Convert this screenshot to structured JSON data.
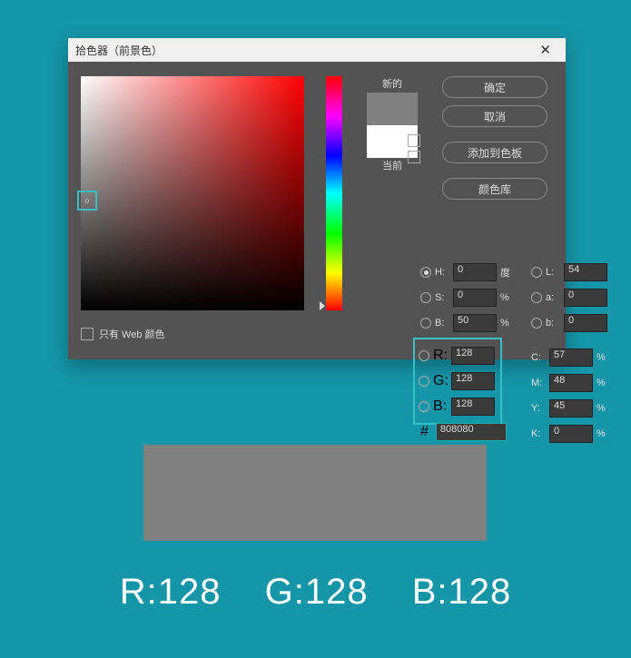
{
  "dialog": {
    "title": "拾色器（前景色）",
    "close": "✕"
  },
  "buttons": {
    "ok": "确定",
    "cancel": "取消",
    "add_swatch": "添加到色板",
    "color_lib": "颜色库"
  },
  "labels": {
    "new": "新的",
    "current": "当前",
    "web_only": "只有 Web 颜色"
  },
  "hsb": {
    "H": {
      "label": "H:",
      "value": "0",
      "unit": "度"
    },
    "S": {
      "label": "S:",
      "value": "0",
      "unit": "%"
    },
    "B": {
      "label": "B:",
      "value": "50",
      "unit": "%"
    }
  },
  "lab": {
    "L": {
      "label": "L:",
      "value": "54"
    },
    "a": {
      "label": "a:",
      "value": "0"
    },
    "b": {
      "label": "b:",
      "value": "0"
    }
  },
  "rgb": {
    "R": {
      "label": "R:",
      "value": "128"
    },
    "G": {
      "label": "G:",
      "value": "128"
    },
    "B": {
      "label": "B:",
      "value": "128"
    }
  },
  "cmyk": {
    "C": {
      "label": "C:",
      "value": "57",
      "unit": "%"
    },
    "M": {
      "label": "M:",
      "value": "48",
      "unit": "%"
    },
    "Y": {
      "label": "Y:",
      "value": "45",
      "unit": "%"
    },
    "K": {
      "label": "K:",
      "value": "0",
      "unit": "%"
    }
  },
  "hex": {
    "prefix": "#",
    "value": "808080"
  },
  "big": {
    "r": "R:128",
    "g": "G:128",
    "b": "B:128"
  }
}
